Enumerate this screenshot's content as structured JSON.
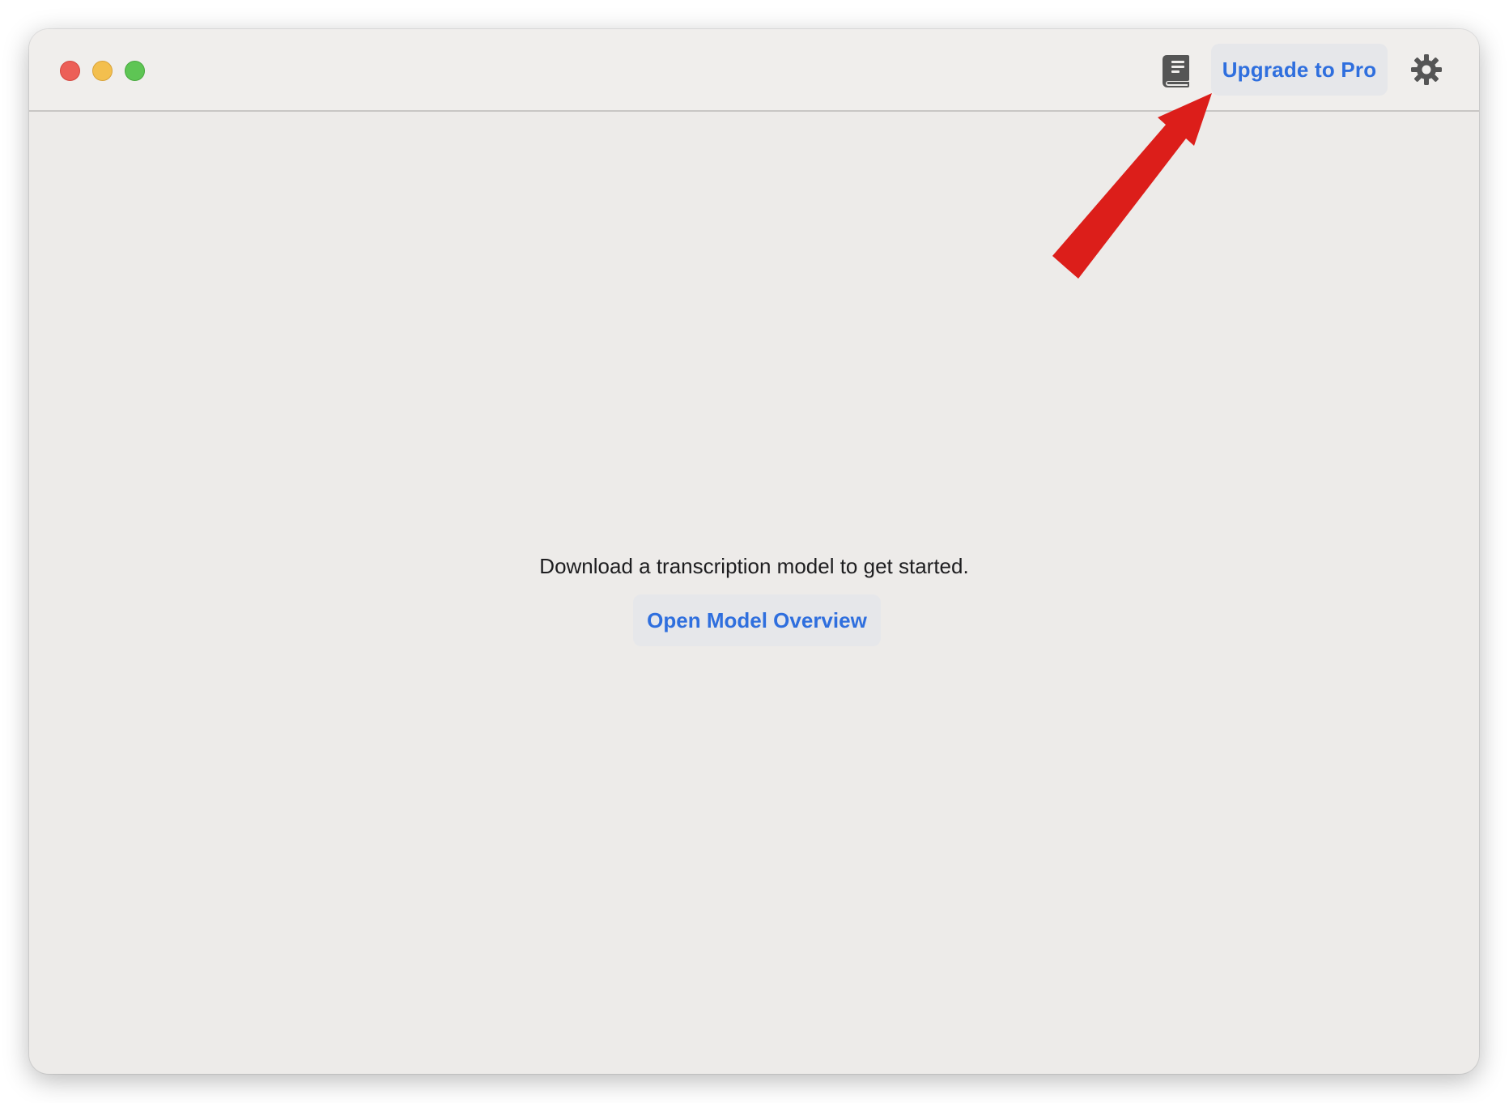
{
  "window": {
    "traffic_lights": [
      "close",
      "minimize",
      "maximize"
    ]
  },
  "toolbar": {
    "library_icon": "book-icon",
    "upgrade_label": "Upgrade to Pro",
    "settings_icon": "gear-icon"
  },
  "main": {
    "message": "Download a transcription model to get started.",
    "open_model_label": "Open Model Overview"
  },
  "annotation": {
    "arrow_color": "#dc1e1a",
    "points_to": "upgrade-button"
  },
  "colors": {
    "accent": "#2f6fde",
    "window_bg": "#edebe9",
    "button_bg": "#e6e7ea"
  }
}
